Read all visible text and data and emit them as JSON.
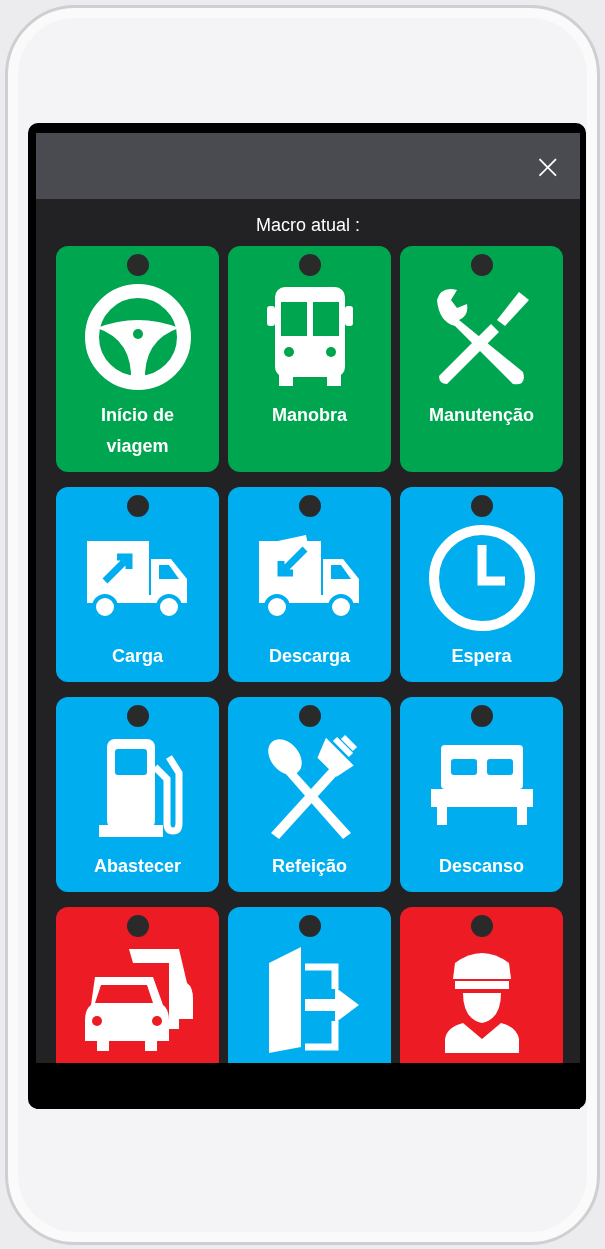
{
  "header": {
    "close": "×"
  },
  "title": "Macro atual :",
  "tiles": [
    {
      "kind": "steering",
      "label": "Início de viagem",
      "color": "#00a54f"
    },
    {
      "kind": "bus",
      "label": "Manobra",
      "color": "#00a54f"
    },
    {
      "kind": "tools",
      "label": "Manutenção",
      "color": "#00a54f"
    },
    {
      "kind": "load",
      "label": "Carga",
      "color": "#00aeef"
    },
    {
      "kind": "unload",
      "label": "Descarga",
      "color": "#00aeef"
    },
    {
      "kind": "clock",
      "label": "Espera",
      "color": "#00aeef"
    },
    {
      "kind": "fuel",
      "label": "Abastecer",
      "color": "#00aeef"
    },
    {
      "kind": "meal",
      "label": "Refeição",
      "color": "#00aeef"
    },
    {
      "kind": "bed",
      "label": "Descanso",
      "color": "#00aeef"
    },
    {
      "kind": "traffic",
      "color": "#ed1c24"
    },
    {
      "kind": "exit",
      "color": "#00aeef"
    },
    {
      "kind": "police",
      "color": "#ed1c24"
    }
  ]
}
